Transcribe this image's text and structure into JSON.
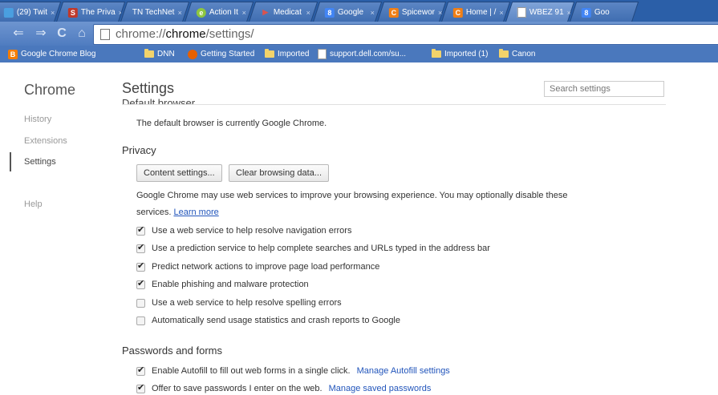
{
  "tabs": [
    {
      "title": "(29) Twit",
      "favicon": "twitter-bird-icon",
      "color": "#4a9fe0",
      "glyph": ""
    },
    {
      "title": "The Priva",
      "favicon": "s-logo-icon",
      "color": "#c0392b",
      "glyph": "S"
    },
    {
      "title": "TN TechNet",
      "favicon": "technet-icon",
      "color": "#3b6bb0",
      "glyph": ""
    },
    {
      "title": "Action It",
      "favicon": "action-icon",
      "color": "#8dc63f",
      "glyph": "e"
    },
    {
      "title": "Medicat",
      "favicon": "medicat-icon",
      "color": "#d9534f",
      "glyph": "▶"
    },
    {
      "title": "Google",
      "favicon": "google-plus-icon",
      "color": "#4285f4",
      "glyph": "8"
    },
    {
      "title": "Spicewor",
      "favicon": "spiceworks-icon",
      "color": "#f07f16",
      "glyph": "C"
    },
    {
      "title": "Home | /",
      "favicon": "home-site-icon",
      "color": "#f07f16",
      "glyph": "C"
    },
    {
      "title": "WBEZ 91",
      "favicon": "page-icon",
      "color": "#ffffff",
      "glyph": ""
    },
    {
      "title": "Goo",
      "favicon": "google-plus-icon",
      "color": "#4285f4",
      "glyph": "8"
    }
  ],
  "omnibox": {
    "prefix": "chrome://",
    "bold": "chrome",
    "suffix": "/settings/"
  },
  "bookmarks": [
    {
      "label": "Google Chrome Blog",
      "icon": "blogger-icon",
      "color": "#f57d00",
      "glyph": "B"
    },
    {
      "label": "DNN",
      "icon": "folder-icon"
    },
    {
      "label": "Getting Started",
      "icon": "firefox-icon",
      "color": "#e66000",
      "glyph": "◕"
    },
    {
      "label": "Imported",
      "icon": "folder-icon"
    },
    {
      "label": "support.dell.com/su...",
      "icon": "page-icon"
    },
    {
      "label": "Imported (1)",
      "icon": "folder-icon"
    },
    {
      "label": "Canon",
      "icon": "folder-icon"
    }
  ],
  "sidebar": {
    "title": "Chrome",
    "items": [
      {
        "label": "History"
      },
      {
        "label": "Extensions"
      },
      {
        "label": "Settings"
      },
      {
        "label": "Help"
      }
    ]
  },
  "settings": {
    "title": "Settings",
    "search_placeholder": "Search settings",
    "clipped_heading": "Default browser",
    "default_browser_text": "The default browser is currently Google Chrome.",
    "privacy_heading": "Privacy",
    "content_settings_btn": "Content settings...",
    "clear_data_btn": "Clear browsing data...",
    "privacy_desc_1": "Google Chrome may use web services to improve your browsing experience. You may optionally disable these",
    "privacy_desc_2": "services.",
    "learn_more": "Learn more",
    "privacy_options": [
      {
        "label": "Use a web service to help resolve navigation errors",
        "checked": true
      },
      {
        "label": "Use a prediction service to help complete searches and URLs typed in the address bar",
        "checked": true
      },
      {
        "label": "Predict network actions to improve page load performance",
        "checked": true
      },
      {
        "label": "Enable phishing and malware protection",
        "checked": true
      },
      {
        "label": "Use a web service to help resolve spelling errors",
        "checked": false
      },
      {
        "label": "Automatically send usage statistics and crash reports to Google",
        "checked": false
      }
    ],
    "passwords_heading": "Passwords and forms",
    "autofill_label": "Enable Autofill to fill out web forms in a single click.",
    "autofill_link": "Manage Autofill settings",
    "autofill_checked": true,
    "passwords_label": "Offer to save passwords I enter on the web.",
    "passwords_link": "Manage saved passwords",
    "passwords_checked": true
  }
}
